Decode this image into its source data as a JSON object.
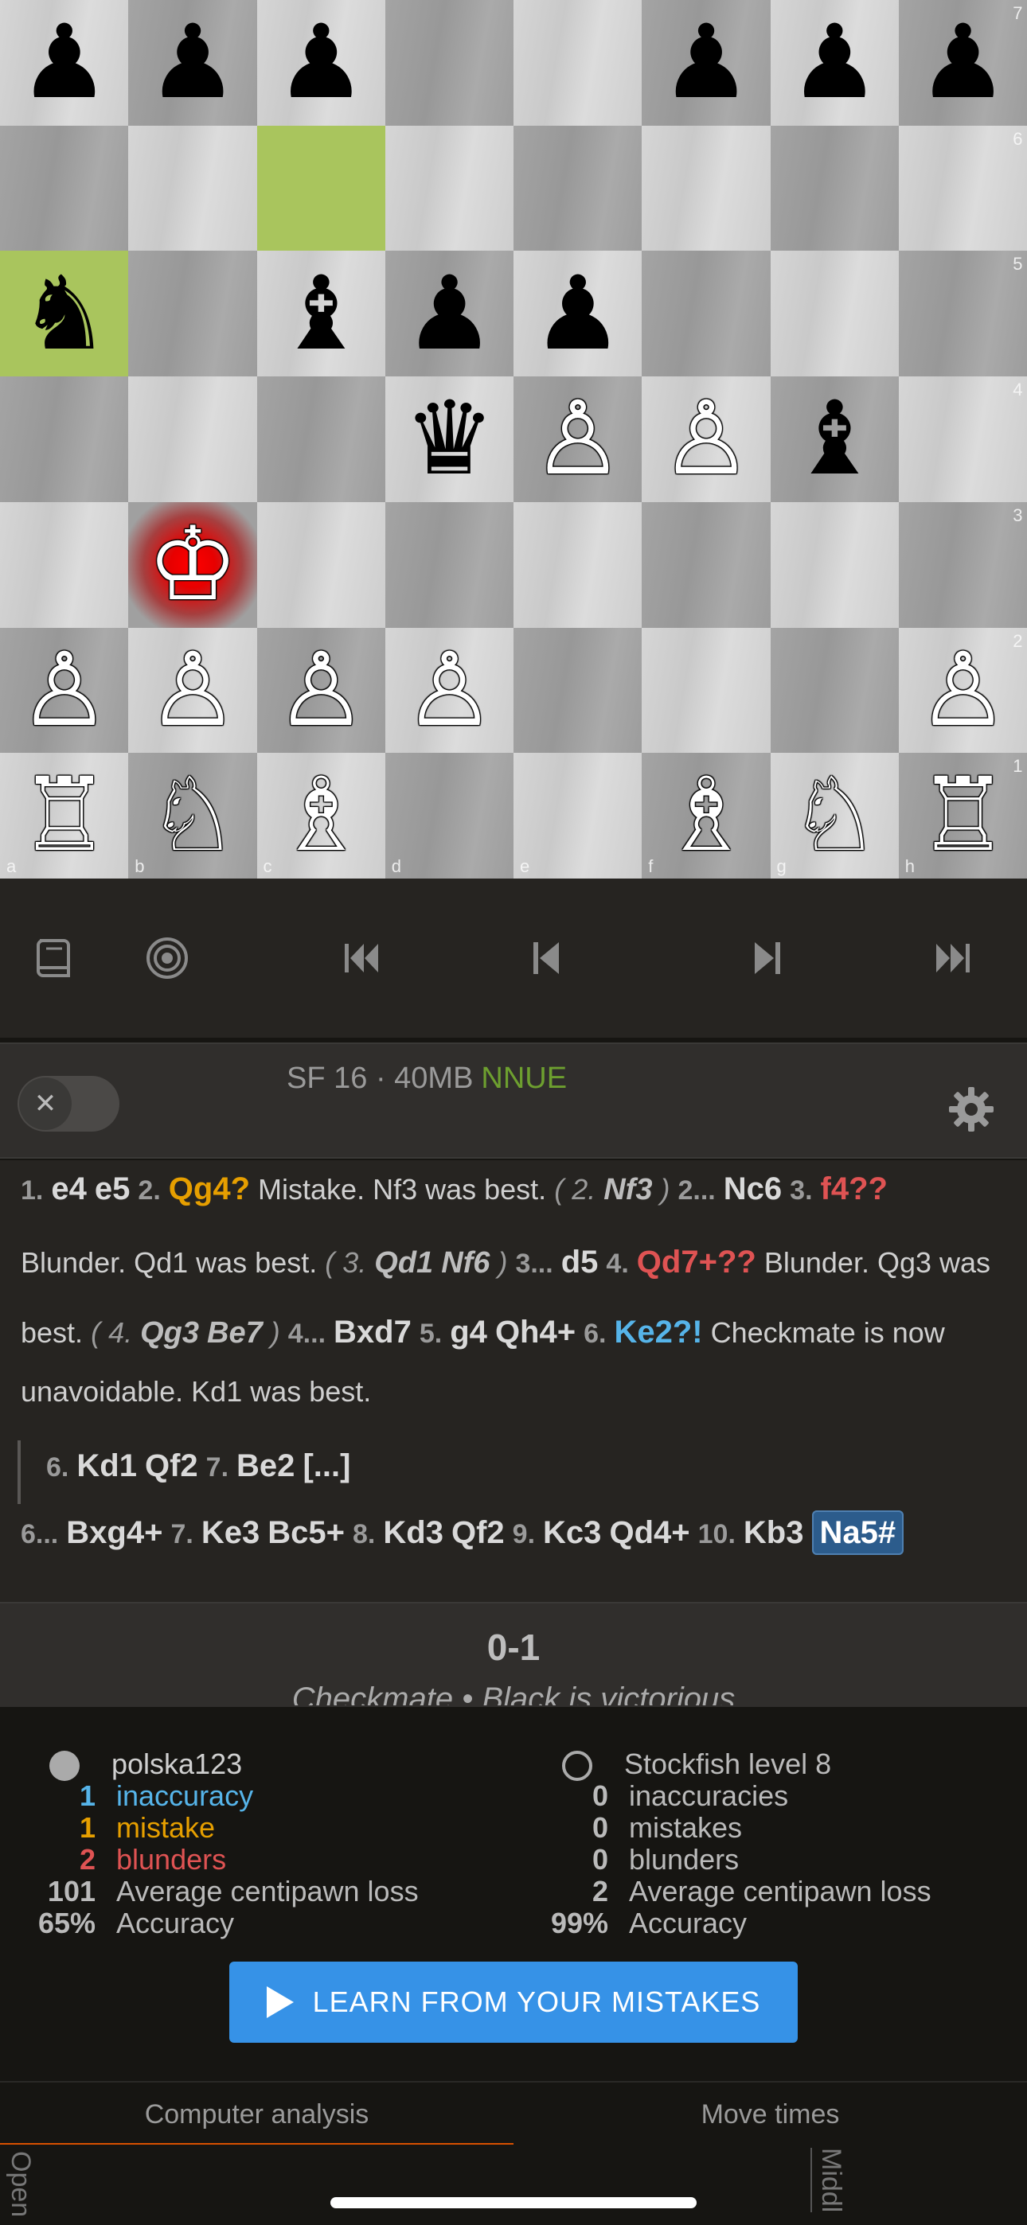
{
  "board": {
    "files": [
      "a",
      "b",
      "c",
      "d",
      "e",
      "f",
      "g",
      "h"
    ],
    "ranks": [
      "7",
      "6",
      "5",
      "4",
      "3",
      "2",
      "1"
    ],
    "highlight_squares": [
      "c6",
      "a5"
    ],
    "check_square": "b3",
    "pieces": [
      {
        "sq": "a7",
        "p": "p",
        "glyph": "♟"
      },
      {
        "sq": "b7",
        "p": "p",
        "glyph": "♟"
      },
      {
        "sq": "c7",
        "p": "p",
        "glyph": "♟"
      },
      {
        "sq": "f7",
        "p": "p",
        "glyph": "♟"
      },
      {
        "sq": "g7",
        "p": "p",
        "glyph": "♟"
      },
      {
        "sq": "h7",
        "p": "p",
        "glyph": "♟"
      },
      {
        "sq": "a5",
        "p": "n",
        "glyph": "♞"
      },
      {
        "sq": "c5",
        "p": "b",
        "glyph": "♝"
      },
      {
        "sq": "d5",
        "p": "p",
        "glyph": "♟"
      },
      {
        "sq": "e5",
        "p": "p",
        "glyph": "♟"
      },
      {
        "sq": "d4",
        "p": "q",
        "glyph": "♛"
      },
      {
        "sq": "e4",
        "p": "P",
        "glyph": "♙"
      },
      {
        "sq": "f4",
        "p": "P",
        "glyph": "♙"
      },
      {
        "sq": "g4",
        "p": "b",
        "glyph": "♝"
      },
      {
        "sq": "b3",
        "p": "K",
        "glyph": "♔"
      },
      {
        "sq": "a2",
        "p": "P",
        "glyph": "♙"
      },
      {
        "sq": "b2",
        "p": "P",
        "glyph": "♙"
      },
      {
        "sq": "c2",
        "p": "P",
        "glyph": "♙"
      },
      {
        "sq": "d2",
        "p": "P",
        "glyph": "♙"
      },
      {
        "sq": "h2",
        "p": "P",
        "glyph": "♙"
      },
      {
        "sq": "a1",
        "p": "R",
        "glyph": "♖"
      },
      {
        "sq": "b1",
        "p": "N",
        "glyph": "♘"
      },
      {
        "sq": "c1",
        "p": "B",
        "glyph": "♗"
      },
      {
        "sq": "f1",
        "p": "B",
        "glyph": "♗"
      },
      {
        "sq": "g1",
        "p": "N",
        "glyph": "♘"
      },
      {
        "sq": "h1",
        "p": "R",
        "glyph": "♖"
      }
    ]
  },
  "controls": {
    "icons": [
      "book-icon",
      "target-icon",
      "first-move-icon",
      "prev-move-icon",
      "next-move-icon",
      "last-move-icon"
    ]
  },
  "engine": {
    "name": "SF 16 · 40MB",
    "badge": "NNUE",
    "toggle_glyph": "✕"
  },
  "moves": {
    "l1": {
      "n1": "1.",
      "m1": "e4",
      "m2": "e5",
      "n2": "2.",
      "m3": "Qg4?",
      "c1": "Mistake. Nf3 was best.",
      "v1n": "2.",
      "v1m": "Nf3",
      "n3": "2...",
      "m4": "Nc6",
      "n4": "3.",
      "m5": "f4??"
    },
    "l2": {
      "c1": "Blunder. Qd1 was best.",
      "vn": "3.",
      "vm1": "Qd1",
      "vm2": "Nf6",
      "n1": "3...",
      "m1": "d5",
      "n2": "4.",
      "m2": "Qd7+??",
      "c2": "Blunder. Qg3 was"
    },
    "l3": {
      "c1": "best.",
      "vn": "4.",
      "vm1": "Qg3",
      "vm2": "Be7",
      "n1": "4...",
      "m1": "Bxd7",
      "n2": "5.",
      "m2": "g4",
      "m3": "Qh4+",
      "n3": "6.",
      "m4": "Ke2?!",
      "c2": "Checkmate is now"
    },
    "l4": {
      "c1": "unavoidable. Kd1 was best."
    },
    "l5": {
      "n1": "6.",
      "m1": "Kd1",
      "m2": "Qf2",
      "n2": "7.",
      "m3": "Be2",
      "more": "[...]"
    },
    "l6": {
      "n1": "6...",
      "m1": "Bxg4+",
      "n2": "7.",
      "m2": "Ke3",
      "m3": "Bc5+",
      "n3": "8.",
      "m4": "Kd3",
      "m5": "Qf2",
      "n4": "9.",
      "m6": "Kc3",
      "m7": "Qd4+",
      "n5": "10.",
      "m8": "Kb3",
      "m9": "Na5#"
    }
  },
  "result": {
    "score": "0-1",
    "status": "Checkmate • Black is victorious"
  },
  "summary": {
    "white": {
      "name": "polska123",
      "inacc_n": "1",
      "inacc": "inaccuracy",
      "mist_n": "1",
      "mist": "mistake",
      "blun_n": "2",
      "blun": "blunders",
      "acpl_n": "101",
      "acpl": "Average centipawn loss",
      "acc_n": "65%",
      "acc": "Accuracy"
    },
    "black": {
      "name": "Stockfish level 8",
      "inacc_n": "0",
      "inacc": "inaccuracies",
      "mist_n": "0",
      "mist": "mistakes",
      "blun_n": "0",
      "blun": "blunders",
      "acpl_n": "2",
      "acpl": "Average centipawn loss",
      "acc_n": "99%",
      "acc": "Accuracy"
    },
    "learn_button": "LEARN FROM YOUR MISTAKES"
  },
  "tabs": [
    "Computer analysis",
    "Move times"
  ],
  "bottom_labels": [
    "Open",
    "Middl"
  ],
  "colors": {
    "mistake": "#e69f00",
    "blunder": "#df5353",
    "inaccuracy": "#56b4e9",
    "accent": "#3692e7",
    "tab_active": "#d85000",
    "nnue": "#6d9f2f"
  }
}
